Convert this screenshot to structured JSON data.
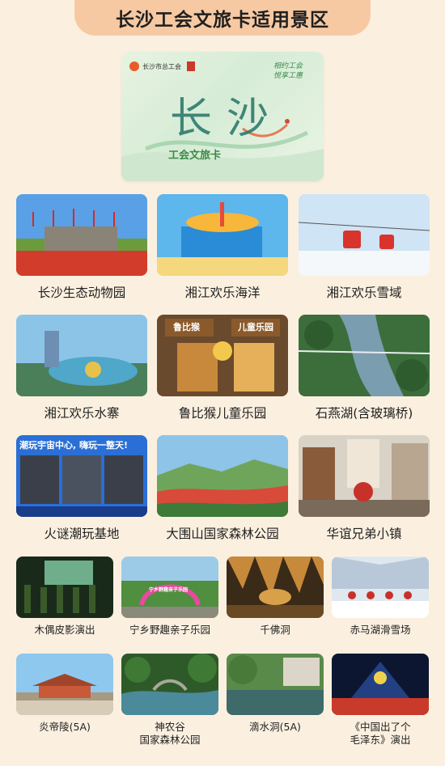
{
  "page_title": "长沙工会文旅卡适用景区",
  "card": {
    "issuer": "长沙市总工会",
    "slogan_line1": "相约工会",
    "slogan_line2": "悦享工惠",
    "art_text": "长沙",
    "card_name": "工会文旅卡"
  },
  "spots_large": [
    {
      "label": "长沙生态动物园",
      "icon": "zoo-scene"
    },
    {
      "label": "湘江欢乐海洋",
      "icon": "ocean-park-scene"
    },
    {
      "label": "湘江欢乐雪域",
      "icon": "snow-park-scene"
    },
    {
      "label": "湘江欢乐水寨",
      "icon": "water-park-scene"
    },
    {
      "label": "鲁比猴儿童乐园",
      "icon": "kids-park-scene"
    },
    {
      "label": "石燕湖(含玻璃桥)",
      "icon": "lake-bridge-scene"
    },
    {
      "label": "火谜潮玩基地",
      "icon": "arcade-scene"
    },
    {
      "label": "大围山国家森林公园",
      "icon": "forest-scene"
    },
    {
      "label": "华谊兄弟小镇",
      "icon": "town-scene"
    }
  ],
  "spots_small": [
    {
      "label": "木偶皮影演出",
      "icon": "puppet-show-scene"
    },
    {
      "label": "宁乡野趣亲子乐园",
      "icon": "family-park-scene"
    },
    {
      "label": "千佛洞",
      "icon": "cave-scene"
    },
    {
      "label": "赤马湖滑雪场",
      "icon": "ski-scene"
    },
    {
      "label": "炎帝陵(5A)",
      "icon": "temple-scene"
    },
    {
      "label": "神农谷",
      "label2": "国家森林公园",
      "icon": "valley-scene"
    },
    {
      "label": "滴水洞(5A)",
      "icon": "pond-scene"
    },
    {
      "label": "《中国出了个",
      "label2": "毛泽东》演出",
      "icon": "stage-show-scene"
    }
  ],
  "photo_texts": {
    "kids_sign_left": "鲁比猴",
    "kids_sign_right": "儿童乐园",
    "arcade_banner": "潮玩宇宙中心, 嗨玩一整天!",
    "family_arch": "宁乡野趣亲子乐园"
  },
  "colors": {
    "background": "#fbf0e0",
    "title_tab": "#f6c9a3",
    "card_green": "#3a8a47"
  }
}
